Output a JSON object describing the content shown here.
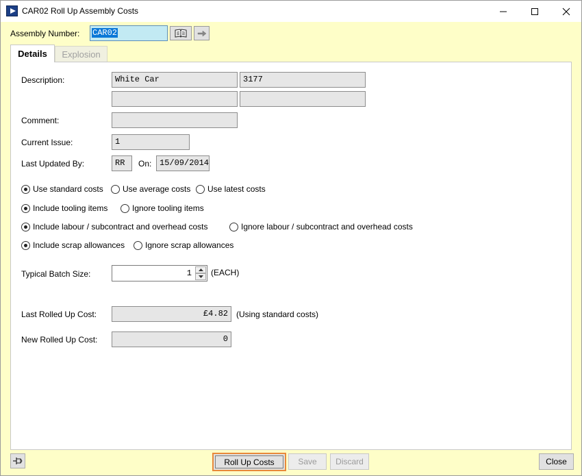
{
  "window": {
    "title": "CAR02 Roll Up Assembly Costs",
    "app_icon": "play-icon"
  },
  "header": {
    "assembly_label": "Assembly Number:",
    "assembly_value": "CAR02",
    "lookup_icon": "book-icon",
    "goto_icon": "arrow-right-icon"
  },
  "tabs": [
    {
      "label": "Details",
      "active": true
    },
    {
      "label": "Explosion",
      "active": false
    }
  ],
  "details": {
    "description_label": "Description:",
    "description": [
      "White Car",
      "3177",
      "",
      ""
    ],
    "comment_label": "Comment:",
    "comment": "",
    "current_issue_label": "Current Issue:",
    "current_issue": "1",
    "last_updated_label": "Last Updated By:",
    "last_updated_by": "RR",
    "on_label": "On:",
    "last_updated_on": "15/09/2014"
  },
  "options": {
    "cost_basis": [
      "Use standard costs",
      "Use average costs",
      "Use latest costs"
    ],
    "tooling": [
      "Include tooling items",
      "Ignore tooling items"
    ],
    "labour": [
      "Include labour / subcontract and overhead costs",
      "Ignore labour / subcontract and overhead costs"
    ],
    "scrap": [
      "Include scrap allowances",
      "Ignore scrap allowances"
    ]
  },
  "batch": {
    "label": "Typical Batch Size:",
    "value": "1",
    "unit": "(EACH)"
  },
  "costs": {
    "last_label": "Last Rolled Up Cost:",
    "last_value": "£4.82",
    "last_note": "(Using standard costs)",
    "new_label": "New Rolled Up Cost:",
    "new_value": "0"
  },
  "footer": {
    "pin_icon": "pin-icon",
    "roll_up_label": "Roll Up Costs",
    "save_label": "Save",
    "discard_label": "Discard",
    "close_label": "Close"
  },
  "colors": {
    "window_bg": "#fefec8",
    "selection": "#0a78d7",
    "focus_border": "#e8893a"
  }
}
